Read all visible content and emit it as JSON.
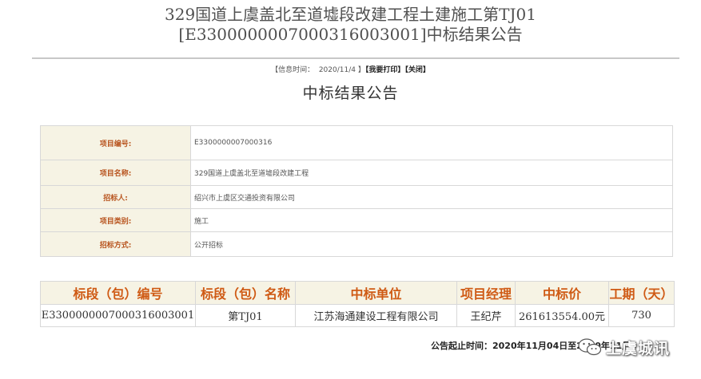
{
  "notice": {
    "title_line1": "329国道上虞盖北至道墟段改建工程土建施工第TJ01",
    "title_line2": "[E3300000007000316003001]中标结果公告",
    "info_time_label": "【信息时间：",
    "info_time_value": "2020/11/4",
    "info_time_close": "】",
    "print_label": "【我要打印】",
    "close_label": "【关闭】",
    "subtitle": "中标结果公告"
  },
  "project_info": [
    {
      "key": "项目编号:",
      "value": "E3300000007000316"
    },
    {
      "key": "项目名称:",
      "value": "329国道上虞盖北至道墟段改建工程"
    },
    {
      "key": "招标人:",
      "value": "绍兴市上虞区交通投资有限公司"
    },
    {
      "key": "项目类别:",
      "value": "施工"
    },
    {
      "key": "招标方式:",
      "value": "公开招标"
    }
  ],
  "result_table": {
    "headers": [
      "标段（包）编号",
      "标段（包）名称",
      "中标单位",
      "项目经理",
      "中标价",
      "工期（天）"
    ],
    "rows": [
      [
        "E3300000007000316003001",
        "第TJ01",
        "江苏海通建设工程有限公司",
        "王纪芹",
        "261613554.00元",
        "730"
      ]
    ]
  },
  "period": {
    "label": "公告起止时间：",
    "text": "2020年11月04日至2020年11月0"
  },
  "watermark": {
    "text": "上虞城讯",
    "icon": "wechat-icon",
    "color": "#ffffff"
  },
  "colors": {
    "label_text": "#b8541e",
    "header_text": "#cf5a14",
    "label_bg": "#f6f3e4"
  }
}
